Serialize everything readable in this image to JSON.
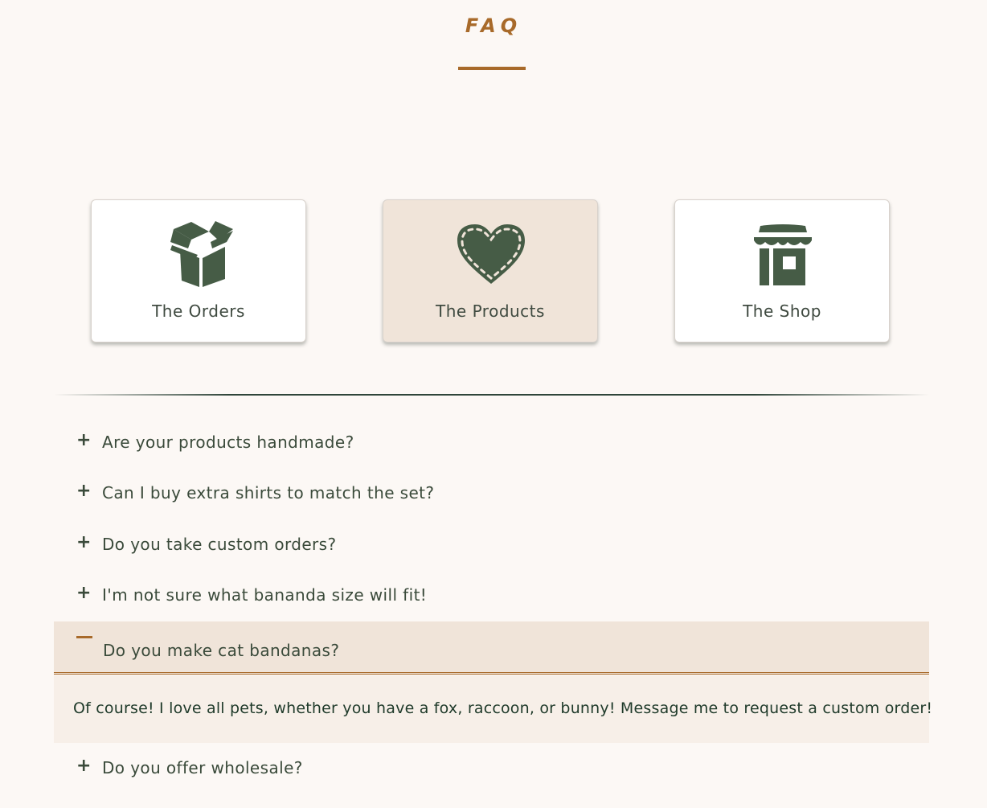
{
  "header": {
    "title": "FAQ"
  },
  "categories": [
    {
      "label": "The Orders",
      "icon": "open-box-icon",
      "active": false
    },
    {
      "label": "The Products",
      "icon": "stitched-heart-icon",
      "active": true
    },
    {
      "label": "The Shop",
      "icon": "storefront-icon",
      "active": false
    }
  ],
  "faq": {
    "items": [
      {
        "question": "Are your products handmade?",
        "toggle": "+",
        "open": false
      },
      {
        "question": "Can I buy extra shirts to match the set?",
        "toggle": "+",
        "open": false
      },
      {
        "question": "Do you take custom orders?",
        "toggle": "+",
        "open": false
      },
      {
        "question": "I'm not sure what bananda size will fit!",
        "toggle": "+",
        "open": false
      },
      {
        "question": "Do you make cat bandanas?",
        "toggle": "",
        "open": true,
        "answer": "Of course! I love all pets, whether you have a fox, raccoon, or bunny! Message me to request a custom order!"
      },
      {
        "question": "Do you offer wholesale?",
        "toggle": "+",
        "open": false
      }
    ]
  },
  "colors": {
    "background": "#fcf8f5",
    "accent": "#a86a2a",
    "icon_green": "#465c46",
    "active_card": "#f0e4d9",
    "answer_bg": "#f7efe8",
    "text": "#3a4a3a"
  }
}
